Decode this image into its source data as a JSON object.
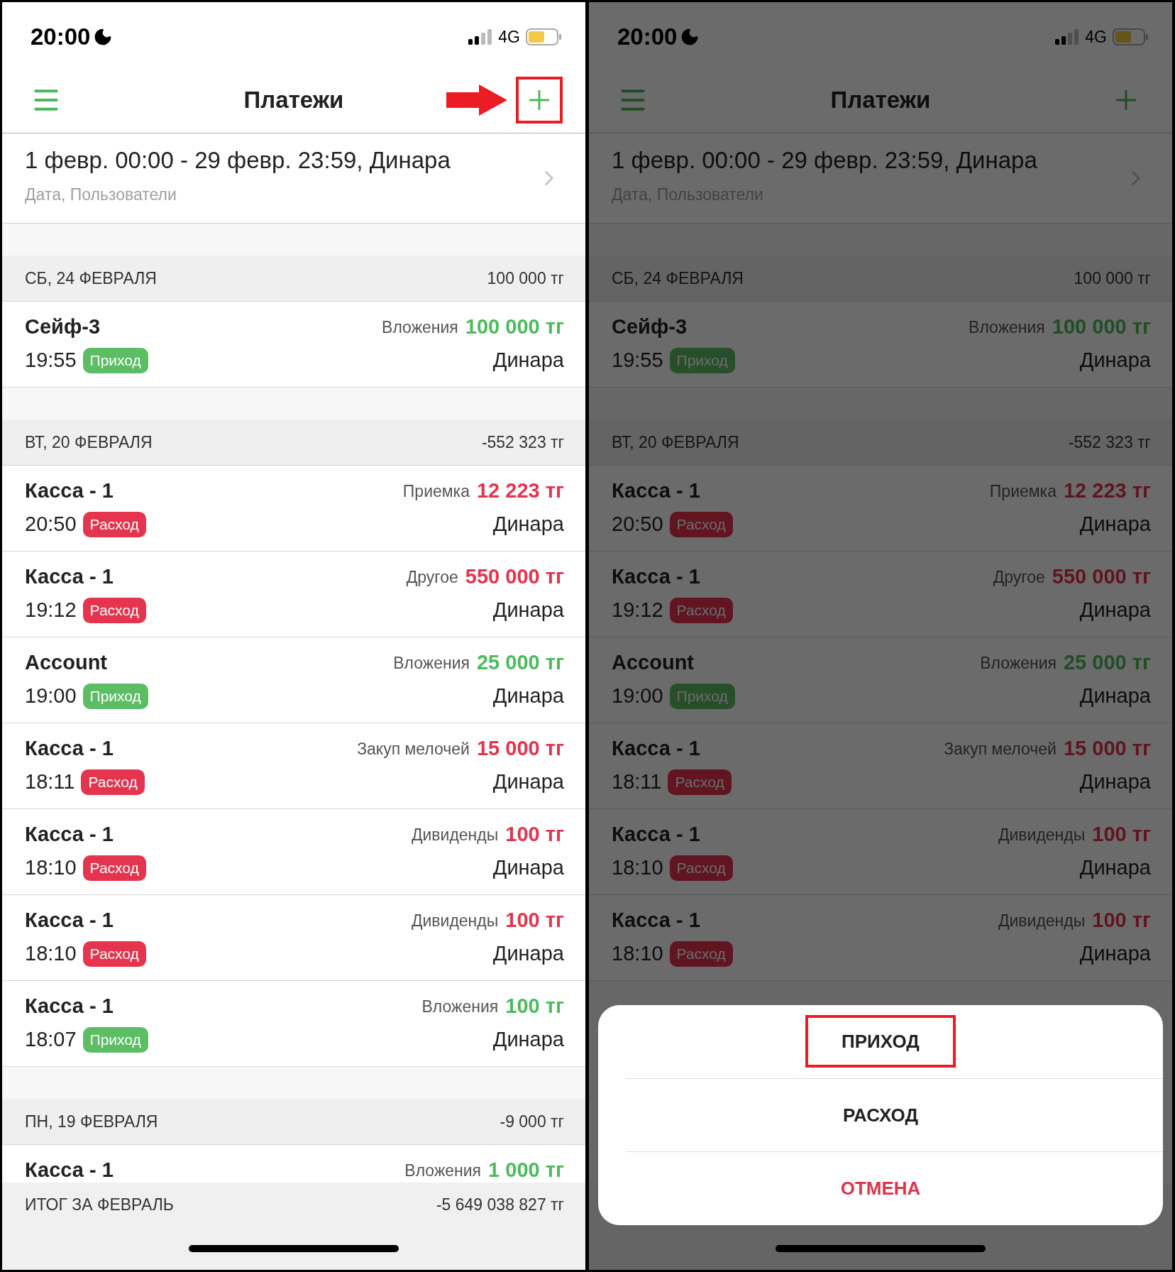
{
  "screens": [
    {
      "dimmed": false,
      "status_bar": {
        "time": "20:00",
        "network": "4G"
      },
      "nav": {
        "title": "Платежи",
        "add_highlighted": true
      },
      "filter": {
        "title": "1 февр. 00:00 - 29 февр. 23:59, Динара",
        "subtitle": "Дата, Пользователи"
      },
      "groups": [
        {
          "date": "СБ, 24 ФЕВРАЛЯ",
          "total": "100 000 тг",
          "rows": [
            {
              "title": "Сейф-3",
              "category": "Вложения",
              "amount": "100 000 тг",
              "time": "19:55",
              "badge": "Приход",
              "kind": "income",
              "user": "Динара"
            }
          ]
        },
        {
          "date": "ВТ, 20 ФЕВРАЛЯ",
          "total": "-552 323 тг",
          "rows": [
            {
              "title": "Касса - 1",
              "category": "Приемка",
              "amount": "12 223 тг",
              "time": "20:50",
              "badge": "Расход",
              "kind": "expense",
              "user": "Динара"
            },
            {
              "title": "Касса - 1",
              "category": "Другое",
              "amount": "550 000 тг",
              "time": "19:12",
              "badge": "Расход",
              "kind": "expense",
              "user": "Динара"
            },
            {
              "title": "Account",
              "category": "Вложения",
              "amount": "25 000 тг",
              "time": "19:00",
              "badge": "Приход",
              "kind": "income",
              "user": "Динара"
            },
            {
              "title": "Касса - 1",
              "category": "Закуп мелочей",
              "amount": "15 000 тг",
              "time": "18:11",
              "badge": "Расход",
              "kind": "expense",
              "user": "Динара"
            },
            {
              "title": "Касса - 1",
              "category": "Дивиденды",
              "amount": "100 тг",
              "time": "18:10",
              "badge": "Расход",
              "kind": "expense",
              "user": "Динара"
            },
            {
              "title": "Касса - 1",
              "category": "Дивиденды",
              "amount": "100 тг",
              "time": "18:10",
              "badge": "Расход",
              "kind": "expense",
              "user": "Динара"
            },
            {
              "title": "Касса - 1",
              "category": "Вложения",
              "amount": "100 тг",
              "time": "18:07",
              "badge": "Приход",
              "kind": "income",
              "user": "Динара"
            }
          ]
        },
        {
          "date": "ПН, 19 ФЕВРАЛЯ",
          "total": "-9 000 тг",
          "rows": [
            {
              "title": "Касса - 1",
              "category": "Вложения",
              "amount": "1 000 тг",
              "kind": "income"
            }
          ]
        }
      ],
      "footer": {
        "label": "ИТОГ ЗА ФЕВРАЛЬ",
        "total": "-5 649 038 827 тг"
      }
    },
    {
      "dimmed": true,
      "status_bar": {
        "time": "20:00",
        "network": "4G"
      },
      "nav": {
        "title": "Платежи",
        "add_highlighted": false
      },
      "filter": {
        "title": "1 февр. 00:00 - 29 февр. 23:59, Динара",
        "subtitle": "Дата, Пользователи"
      },
      "groups": [
        {
          "date": "СБ, 24 ФЕВРАЛЯ",
          "total": "100 000 тг",
          "rows": [
            {
              "title": "Сейф-3",
              "category": "Вложения",
              "amount": "100 000 тг",
              "time": "19:55",
              "badge": "Приход",
              "kind": "income",
              "user": "Динара"
            }
          ]
        },
        {
          "date": "ВТ, 20 ФЕВРАЛЯ",
          "total": "-552 323 тг",
          "rows": [
            {
              "title": "Касса - 1",
              "category": "Приемка",
              "amount": "12 223 тг",
              "time": "20:50",
              "badge": "Расход",
              "kind": "expense",
              "user": "Динара"
            },
            {
              "title": "Касса - 1",
              "category": "Другое",
              "amount": "550 000 тг",
              "time": "19:12",
              "badge": "Расход",
              "kind": "expense",
              "user": "Динара"
            },
            {
              "title": "Account",
              "category": "Вложения",
              "amount": "25 000 тг",
              "time": "19:00",
              "badge": "Приход",
              "kind": "income",
              "user": "Динара"
            },
            {
              "title": "Касса - 1",
              "category": "Закуп мелочей",
              "amount": "15 000 тг",
              "time": "18:11",
              "badge": "Расход",
              "kind": "expense",
              "user": "Динара"
            },
            {
              "title": "Касса - 1",
              "category": "Дивиденды",
              "amount": "100 тг",
              "time": "18:10",
              "badge": "Расход",
              "kind": "expense",
              "user": "Динара"
            },
            {
              "title": "Касса - 1",
              "category": "Дивиденды",
              "amount": "100 тг",
              "time": "18:10",
              "badge": "Расход",
              "kind": "expense",
              "user": "Динара"
            }
          ]
        }
      ],
      "action_sheet": {
        "options": [
          {
            "label": "ПРИХОД",
            "kind": "default",
            "highlighted": true
          },
          {
            "label": "РАСХОД",
            "kind": "default",
            "highlighted": false
          },
          {
            "label": "ОТМЕНА",
            "kind": "cancel",
            "highlighted": false
          }
        ]
      }
    }
  ]
}
